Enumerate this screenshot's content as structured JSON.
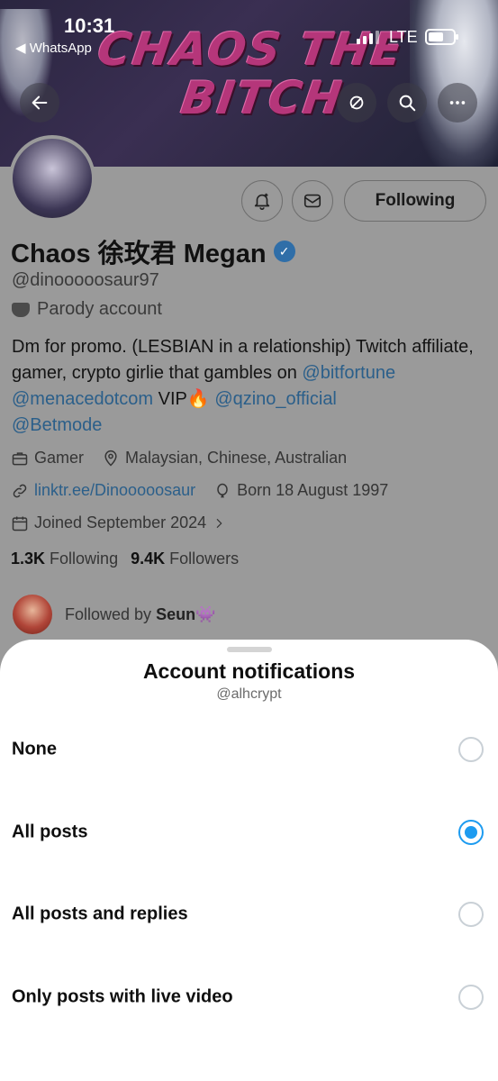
{
  "status_bar": {
    "time": "10:31",
    "back_app": "◀ WhatsApp",
    "network": "LTE"
  },
  "banner": {
    "text_line1": "CHAOS THE",
    "text_line2": "BITCH"
  },
  "profile": {
    "following_label": "Following",
    "display_name": "Chaos 徐玫君 Megan",
    "handle": "@dinooooosaur97",
    "parody_label": "Parody account",
    "bio": {
      "text1": "Dm for promo. (LESBIAN in a relationship) Twitch affiliate, gamer, crypto girlie that gambles on ",
      "link1": "@bitfortune",
      "link2": "@menacedotcom",
      "text2": " VIP🔥 ",
      "link3": "@qzino_official",
      "link4": "@Betmode"
    },
    "category": "Gamer",
    "location": "Malaysian, Chinese, Australian",
    "website": "linktr.ee/Dinooooosaur",
    "birthday": "Born 18 August 1997",
    "joined": "Joined September 2024",
    "following_count": "1.3K",
    "following_text": "Following",
    "followers_count": "9.4K",
    "followers_text": "Followers",
    "followed_by_text": "Followed by ",
    "followed_by_name": "Seun👾"
  },
  "sheet": {
    "title": "Account notifications",
    "subtitle": "@alhcrypt",
    "options": [
      {
        "label": "None",
        "selected": false
      },
      {
        "label": "All posts",
        "selected": true
      },
      {
        "label": "All posts and replies",
        "selected": false
      },
      {
        "label": "Only posts with live video",
        "selected": false
      }
    ]
  },
  "colors": {
    "accent": "#1d9bf0",
    "link": "#2b5f8a",
    "banner_text": "#b5367a"
  }
}
